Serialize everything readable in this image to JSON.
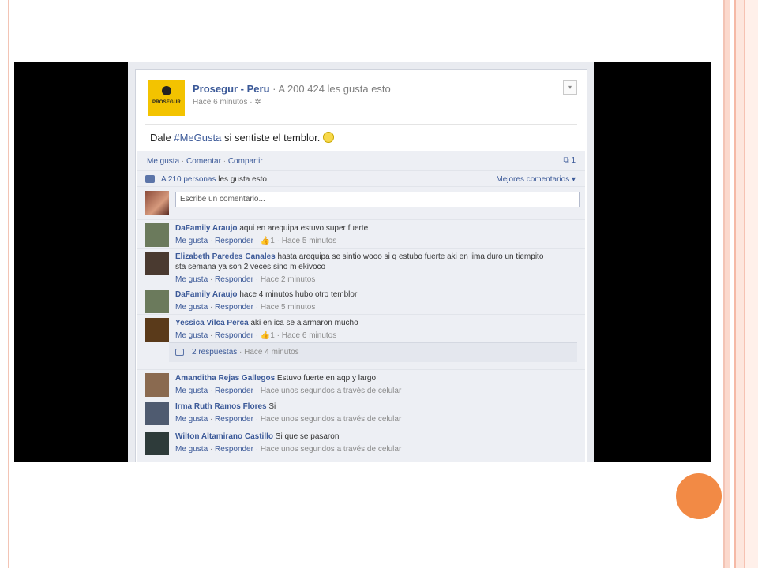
{
  "post": {
    "page_name": "Prosegur - Peru",
    "likes_text": "· A 200 424 les gusta esto",
    "time": "Hace 6 minutos · ",
    "logo_text": "PROSEGUR",
    "text_before": "Dale ",
    "hashtag": "#MeGusta",
    "text_after": " si sentiste el temblor. "
  },
  "actions": {
    "like": "Me gusta",
    "sep1": " · ",
    "comment": "Comentar",
    "sep2": " · ",
    "share": "Compartir",
    "share_count": "1"
  },
  "likes_summary": {
    "count_link": "A 210 personas",
    "rest": " les gusta esto.",
    "sort": "Mejores comentarios ▾"
  },
  "compose": {
    "placeholder": "Escribe un comentario..."
  },
  "comments": [
    {
      "author": "DaFamily Araujo",
      "text": " aqui en arequipa estuvo super fuerte",
      "like": "Me gusta",
      "reply": "Responder",
      "extra": " · 👍1 · Hace 5 minutos",
      "avatar_color": "#6b7a5c"
    },
    {
      "author": "Elizabeth Paredes Canales",
      "text": " hasta arequipa se sintio wooo si q estubo fuerte aki en lima duro un tiempito sta semana ya son 2 veces sino m ekivoco",
      "like": "Me gusta",
      "reply": "Responder",
      "extra": " · Hace 2 minutos",
      "avatar_color": "#4a3a30"
    },
    {
      "author": "DaFamily Araujo",
      "text": " hace 4 minutos hubo otro temblor",
      "like": "Me gusta",
      "reply": "Responder",
      "extra": " · Hace 5 minutos",
      "avatar_color": "#6b7a5c"
    },
    {
      "author": "Yessica Vilca Perca",
      "text": " aki en ica se alarmaron mucho",
      "like": "Me gusta",
      "reply": "Responder",
      "extra": " · 👍1 · Hace 6 minutos",
      "avatar_color": "#5a3a1a"
    },
    {
      "author": "Amanditha Rejas Gallegos",
      "text": " Estuvo fuerte en aqp y largo",
      "like": "Me gusta",
      "reply": "Responder",
      "extra": " · Hace unos segundos a través de celular",
      "avatar_color": "#8a6a50"
    },
    {
      "author": "Irma Ruth Ramos Flores",
      "text": " Si",
      "like": "Me gusta",
      "reply": "Responder",
      "extra": " · Hace unos segundos a través de celular",
      "avatar_color": "#4f5b70"
    },
    {
      "author": "Wilton Altamirano Castillo",
      "text": " Si que se pasaron",
      "like": "Me gusta",
      "reply": "Responder",
      "extra": " · Hace unos segundos a través de celular",
      "avatar_color": "#2e3b3a"
    }
  ],
  "replies": {
    "count": "2 respuestas",
    "time": " · Hace 4 minutos"
  },
  "colors": {
    "facebook_blue": "#3b5998",
    "accent_orange": "#f28a45",
    "logo_yellow": "#f3c300"
  }
}
